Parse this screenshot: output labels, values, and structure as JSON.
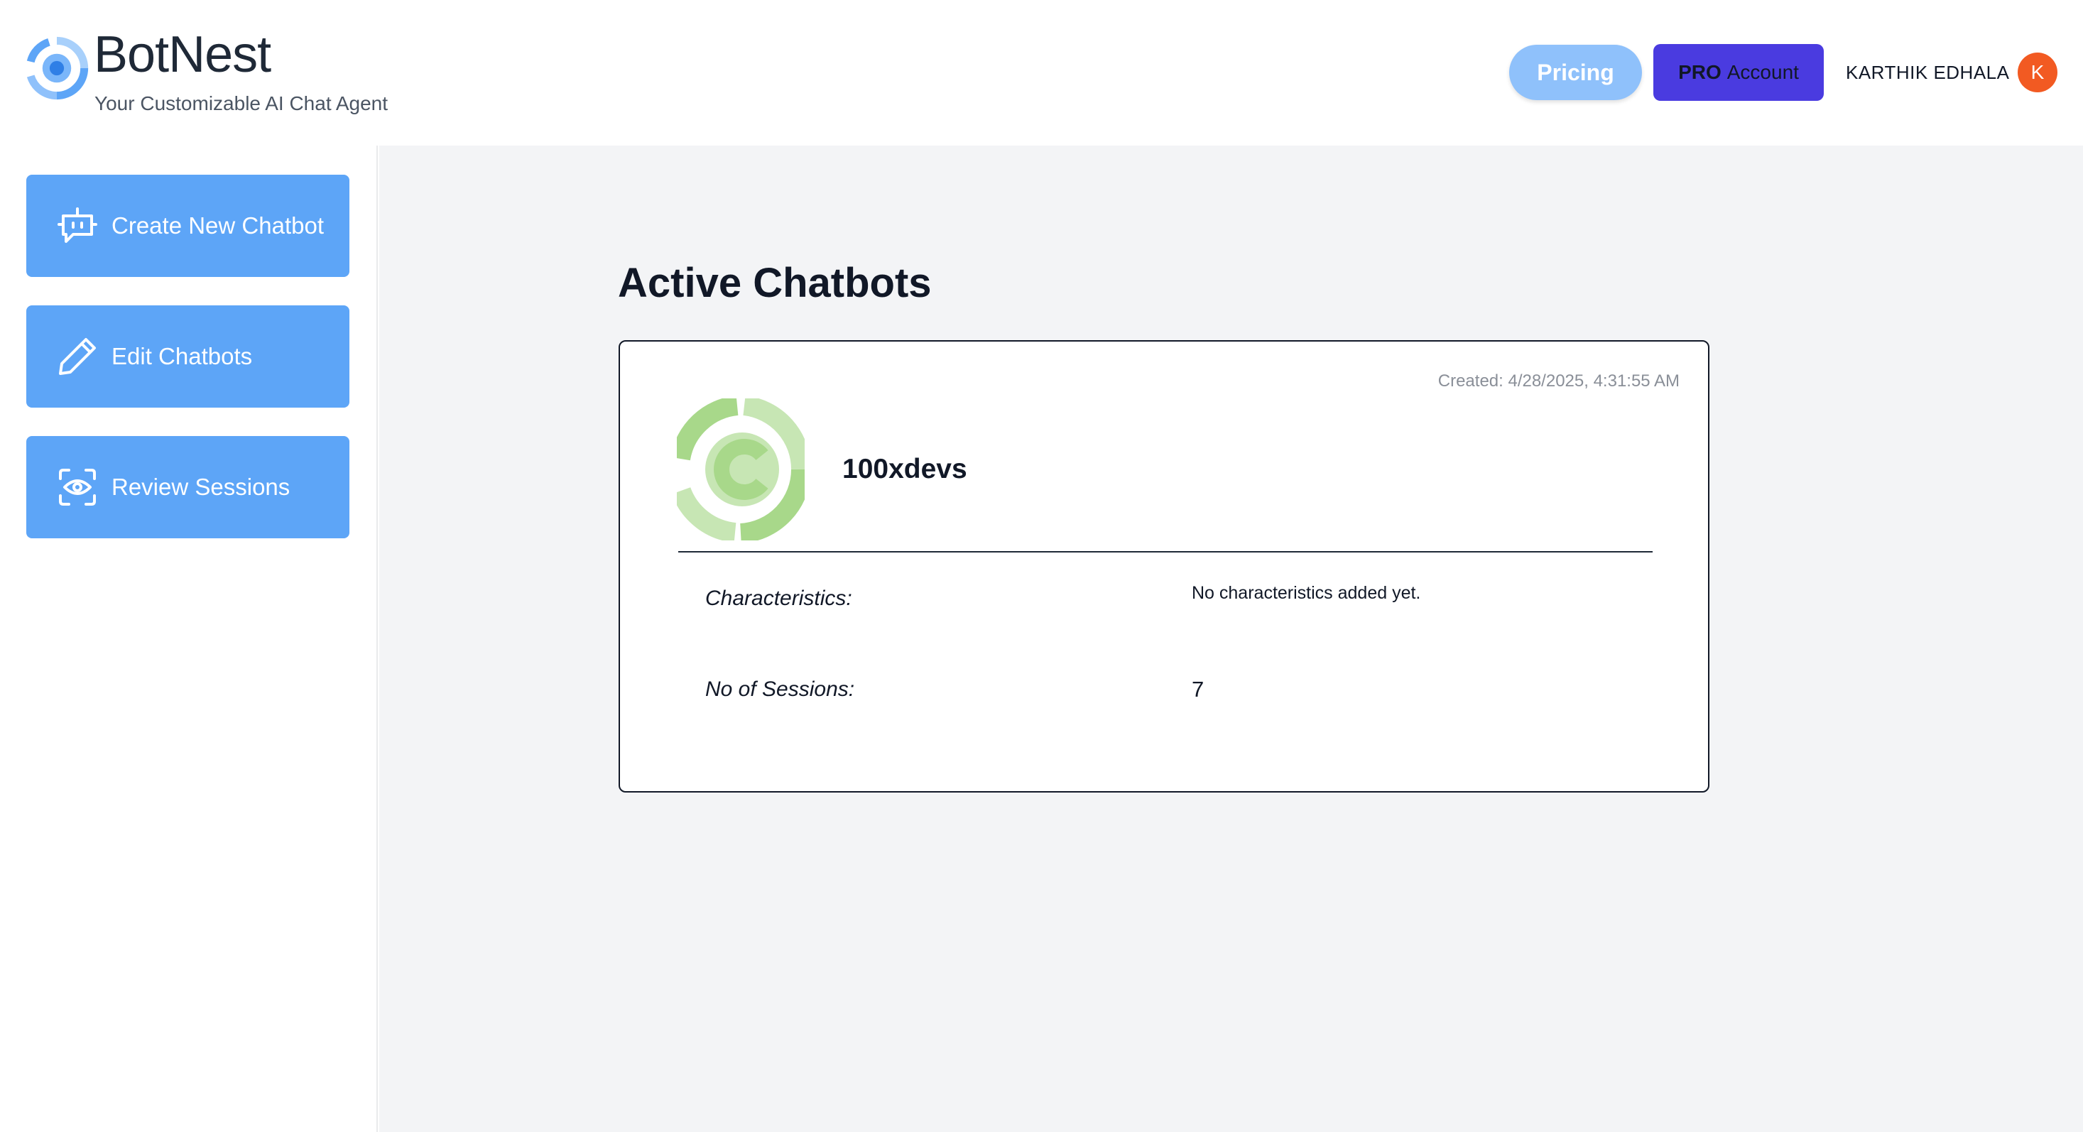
{
  "brand": {
    "name": "BotNest",
    "tagline": "Your Customizable AI Chat Agent"
  },
  "header": {
    "pricing_label": "Pricing",
    "pro_label_strong": "PRO",
    "pro_label_rest": "Account",
    "user_name": "KARTHIK EDHALA",
    "avatar_initial": "K"
  },
  "sidebar": {
    "items": [
      {
        "label": "Create New Chatbot",
        "icon": "robot-icon"
      },
      {
        "label": "Edit Chatbots",
        "icon": "pencil-icon"
      },
      {
        "label": "Review Sessions",
        "icon": "eye-scan-icon"
      }
    ]
  },
  "main": {
    "title": "Active Chatbots",
    "chatbots": [
      {
        "created": "Created: 4/28/2025, 4:31:55 AM",
        "name": "100xdevs",
        "characteristics_label": "Characteristics:",
        "characteristics_value": "No characteristics added yet.",
        "sessions_label": "No of Sessions:",
        "sessions_value": "7"
      }
    ]
  },
  "colors": {
    "accent": "#5da5f7",
    "pricing": "#8fc1fb",
    "pro": "#4a3be0",
    "avatar": "#f25a22",
    "bot_logo": "#a8d88a"
  }
}
